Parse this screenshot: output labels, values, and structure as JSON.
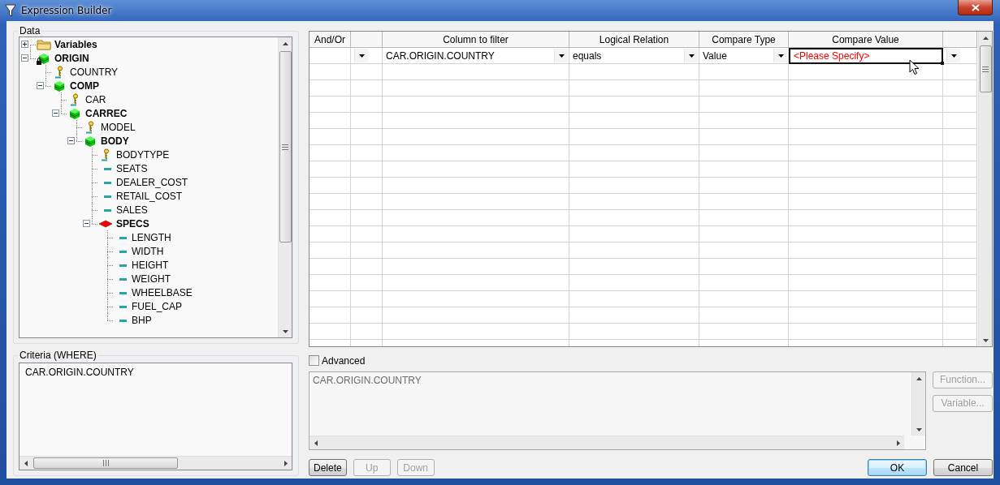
{
  "window": {
    "title": "Expression Builder"
  },
  "data_panel": {
    "label": "Data",
    "tree": [
      {
        "kind": "folder",
        "label": "Variables",
        "expanded": false
      },
      {
        "kind": "locked-segment",
        "label": "ORIGIN",
        "expanded": true,
        "children": [
          {
            "kind": "key-field",
            "label": "COUNTRY"
          },
          {
            "kind": "segment",
            "label": "COMP",
            "expanded": true,
            "children": [
              {
                "kind": "key-field",
                "label": "CAR"
              },
              {
                "kind": "segment",
                "label": "CARREC",
                "expanded": true,
                "children": [
                  {
                    "kind": "key-field",
                    "label": "MODEL"
                  },
                  {
                    "kind": "segment",
                    "label": "BODY",
                    "expanded": true,
                    "children": [
                      {
                        "kind": "key-field",
                        "label": "BODYTYPE"
                      },
                      {
                        "kind": "field",
                        "label": "SEATS"
                      },
                      {
                        "kind": "field",
                        "label": "DEALER_COST"
                      },
                      {
                        "kind": "field",
                        "label": "RETAIL_COST"
                      },
                      {
                        "kind": "field",
                        "label": "SALES"
                      },
                      {
                        "kind": "diamond-segment",
                        "label": "SPECS",
                        "expanded": true,
                        "children": [
                          {
                            "kind": "field",
                            "label": "LENGTH"
                          },
                          {
                            "kind": "field",
                            "label": "WIDTH"
                          },
                          {
                            "kind": "field",
                            "label": "HEIGHT"
                          },
                          {
                            "kind": "field",
                            "label": "WEIGHT"
                          },
                          {
                            "kind": "field",
                            "label": "WHEELBASE"
                          },
                          {
                            "kind": "field",
                            "label": "FUEL_CAP"
                          },
                          {
                            "kind": "field",
                            "label": "BHP"
                          }
                        ]
                      }
                    ]
                  }
                ]
              }
            ]
          }
        ]
      }
    ]
  },
  "criteria": {
    "label": "Criteria (WHERE)",
    "text": "CAR.ORIGIN.COUNTRY"
  },
  "grid": {
    "columns": [
      {
        "kind": "header",
        "label": "And/Or"
      },
      {
        "kind": "blank"
      },
      {
        "kind": "header",
        "label": "Column to filter"
      },
      {
        "kind": "header",
        "label": "Logical Relation"
      },
      {
        "kind": "header",
        "label": "Compare Type"
      },
      {
        "kind": "header",
        "label": "Compare Value"
      },
      {
        "kind": "blank"
      }
    ],
    "rows": [
      {
        "cells": [
          {
            "kind": "empty"
          },
          {
            "kind": "dropdown"
          },
          {
            "kind": "dropdown",
            "value": "CAR.ORIGIN.COUNTRY"
          },
          {
            "kind": "dropdown",
            "value": "equals"
          },
          {
            "kind": "dropdown",
            "value": "Value"
          },
          {
            "kind": "prompt",
            "value": "<Please Specify>",
            "focused": true
          },
          {
            "kind": "dropdown"
          }
        ]
      }
    ]
  },
  "advanced": {
    "label": "Advanced",
    "checked": false
  },
  "expression": {
    "text": "CAR.ORIGIN.COUNTRY",
    "disabled": true
  },
  "side_buttons": [
    {
      "label": "Function...",
      "disabled": true
    },
    {
      "label": "Variable...",
      "disabled": true
    }
  ],
  "row_buttons": [
    {
      "label": "Delete",
      "disabled": false
    },
    {
      "label": "Up",
      "disabled": true
    },
    {
      "label": "Down",
      "disabled": true
    }
  ],
  "dialog_buttons": [
    {
      "label": "OK",
      "default": true
    },
    {
      "label": "Cancel",
      "default": false
    }
  ]
}
